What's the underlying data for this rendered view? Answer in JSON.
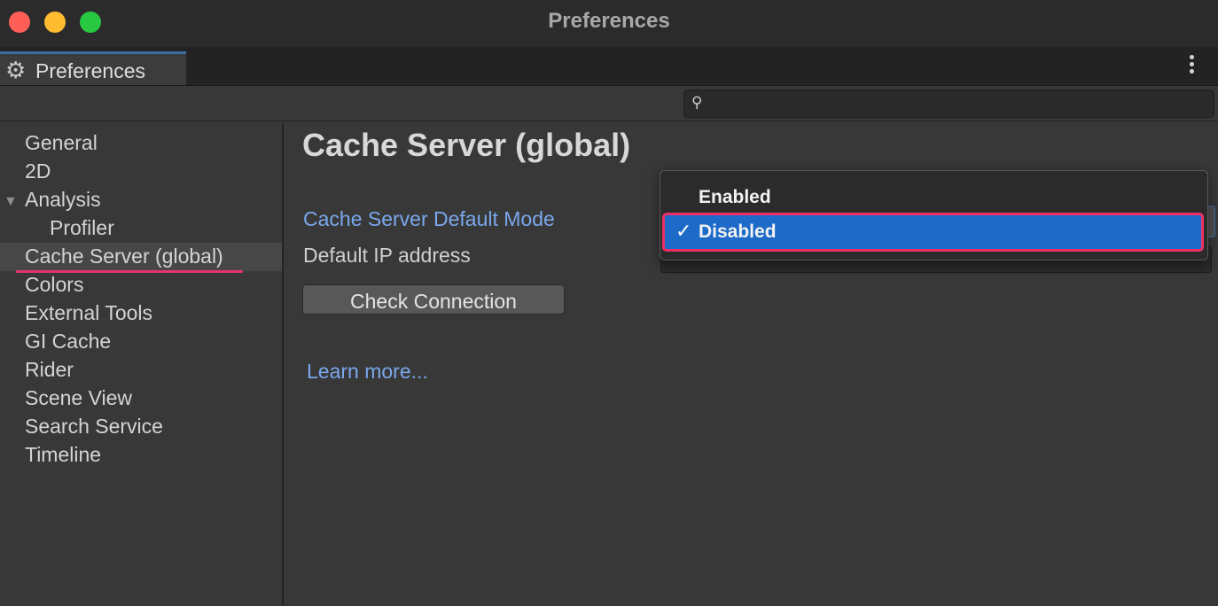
{
  "window": {
    "title": "Preferences",
    "traffic_lights": {
      "close_color": "#ff5f57",
      "minimize_color": "#febc2e",
      "maximize_color": "#28c840"
    }
  },
  "tab": {
    "icon": "gear-icon",
    "label": "Preferences"
  },
  "toolbar": {
    "more_icon": "kebab-menu-icon"
  },
  "search": {
    "icon": "search-icon",
    "value": "",
    "placeholder": ""
  },
  "sidebar": {
    "items": [
      {
        "label": "General"
      },
      {
        "label": "2D"
      },
      {
        "label": "Analysis",
        "expanded": true
      },
      {
        "label": "Profiler",
        "child": true
      },
      {
        "label": "Cache Server (global)",
        "selected": true
      },
      {
        "label": "Colors"
      },
      {
        "label": "External Tools"
      },
      {
        "label": "GI Cache"
      },
      {
        "label": "Rider"
      },
      {
        "label": "Scene View"
      },
      {
        "label": "Search Service"
      },
      {
        "label": "Timeline"
      }
    ]
  },
  "main": {
    "title": "Cache Server (global)",
    "default_mode_label": "Cache Server Default Mode",
    "ip_label": "Default IP address",
    "ip_value": "",
    "check_button": "Check Connection",
    "learn_more": "Learn more..."
  },
  "dropdown": {
    "options": [
      {
        "label": "Enabled",
        "selected": false
      },
      {
        "label": "Disabled",
        "selected": true
      }
    ],
    "check_mark": "✓"
  },
  "colors": {
    "highlight": "#1d6ac8",
    "annotation": "#ee2f67",
    "link": "#7aa7ec"
  }
}
